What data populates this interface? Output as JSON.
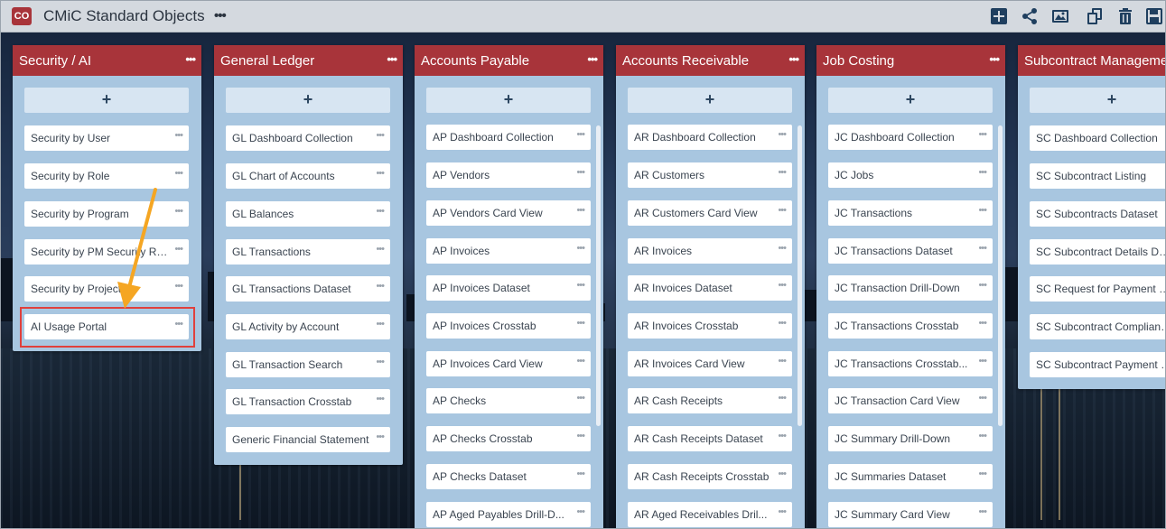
{
  "app": {
    "badge": "CO",
    "title": "CMiC Standard Objects",
    "more": "•••"
  },
  "toolbar": {
    "icons": [
      "add-icon",
      "share-icon",
      "image-icon",
      "copy-icon",
      "trash-icon",
      "save-icon"
    ],
    "icon_color": "#1f3f5f"
  },
  "colors": {
    "header": "#a8343a",
    "column": "#a8c6e0",
    "highlight": "#e0403c",
    "arrow": "#f5a623"
  },
  "columns": [
    {
      "title": "Security / AI",
      "add": "+",
      "menu": "•••",
      "items": [
        "Security by User",
        "Security by Role",
        "Security by Program",
        "Security by PM Security Role",
        "Security by Project",
        "AI Usage Portal"
      ]
    },
    {
      "title": "General Ledger",
      "add": "+",
      "menu": "•••",
      "items": [
        "GL Dashboard Collection",
        "GL Chart of Accounts",
        "GL Balances",
        "GL Transactions",
        "GL Transactions Dataset",
        "GL Activity by Account",
        "GL Transaction Search",
        "GL Transaction Crosstab",
        "Generic Financial Statement"
      ]
    },
    {
      "title": "Accounts Payable",
      "add": "+",
      "menu": "•••",
      "items": [
        "AP Dashboard Collection",
        "AP Vendors",
        "AP Vendors Card View",
        "AP Invoices",
        "AP Invoices Dataset",
        "AP Invoices Crosstab",
        "AP Invoices Card View",
        "AP Checks",
        "AP Checks Crosstab",
        "AP Checks Dataset",
        "AP Aged Payables Drill-D..."
      ]
    },
    {
      "title": "Accounts Receivable",
      "add": "+",
      "menu": "•••",
      "items": [
        "AR Dashboard Collection",
        "AR Customers",
        "AR Customers Card View",
        "AR Invoices",
        "AR Invoices Dataset",
        "AR Invoices Crosstab",
        "AR Invoices Card View",
        "AR Cash Receipts",
        "AR Cash Receipts Dataset",
        "AR Cash Receipts Crosstab",
        "AR Aged Receivables Dril..."
      ]
    },
    {
      "title": "Job Costing",
      "add": "+",
      "menu": "•••",
      "items": [
        "JC Dashboard Collection",
        "JC Jobs",
        "JC Transactions",
        "JC Transactions Dataset",
        "JC Transaction Drill-Down",
        "JC Transactions Crosstab",
        "JC Transactions Crosstab...",
        "JC Transaction Card View",
        "JC Summary Drill-Down",
        "JC Summaries Dataset",
        "JC Summary Card View"
      ]
    },
    {
      "title": "Subcontract Management",
      "add": "+",
      "menu": "•••",
      "items": [
        "SC Dashboard Collection",
        "SC Subcontract Listing",
        "SC Subcontracts Dataset",
        "SC Subcontract Details Dat...",
        "SC Request for Payment Li...",
        "SC Subcontract Complianc...",
        "SC Subcontract Payment D..."
      ]
    }
  ],
  "item_menu": "•••"
}
